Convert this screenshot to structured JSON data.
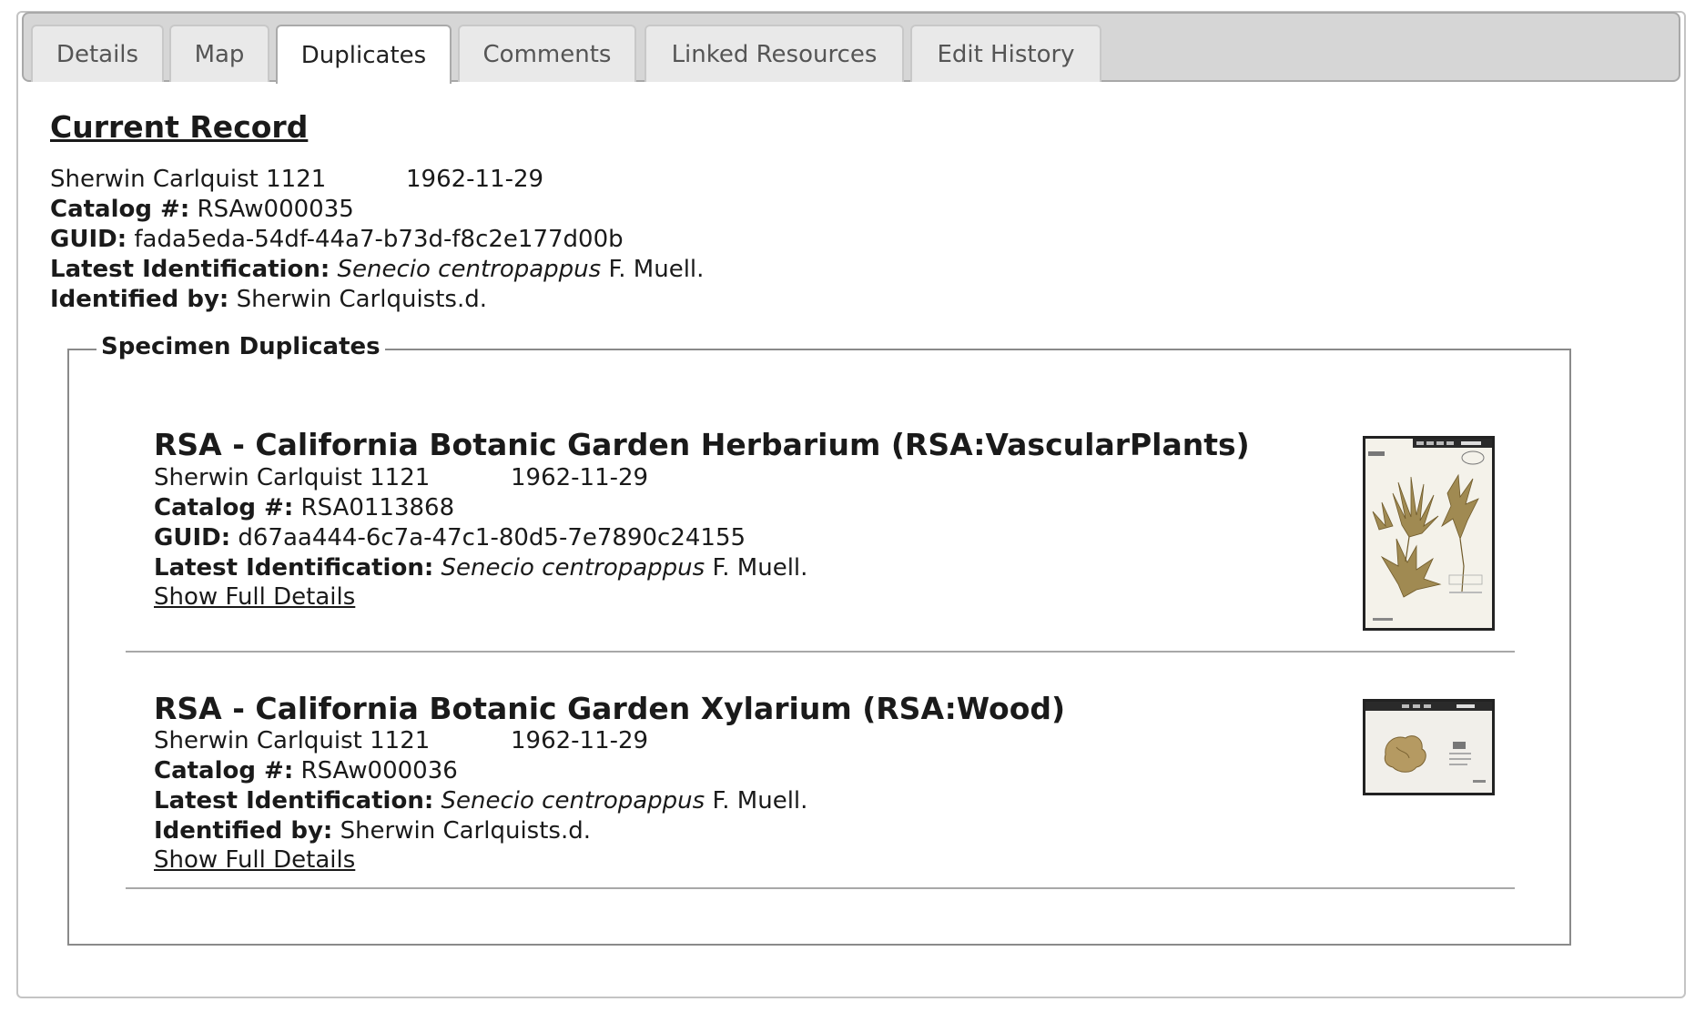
{
  "tabs": [
    {
      "label": "Details"
    },
    {
      "label": "Map"
    },
    {
      "label": "Duplicates"
    },
    {
      "label": "Comments"
    },
    {
      "label": "Linked Resources"
    },
    {
      "label": "Edit History"
    }
  ],
  "current_record": {
    "heading": "Current Record",
    "collector": "Sherwin Carlquist 1121",
    "date": "1962-11-29",
    "catalog_label": "Catalog #:",
    "catalog_value": "RSAw000035",
    "guid_label": "GUID:",
    "guid_value": "fada5eda-54df-44a7-b73d-f8c2e177d00b",
    "latest_id_label": "Latest Identification:",
    "latest_id_taxon": "Senecio centropappus",
    "latest_id_author": "F. Muell.",
    "identified_by_label": "Identified by:",
    "identified_by_value": "Sherwin Carlquists.d."
  },
  "duplicates": {
    "legend": "Specimen Duplicates",
    "items": [
      {
        "title": "RSA - California Botanic Garden Herbarium (RSA:VascularPlants)",
        "collector": "Sherwin Carlquist 1121",
        "date": "1962-11-29",
        "catalog_label": "Catalog #:",
        "catalog_value": "RSA0113868",
        "guid_label": "GUID:",
        "guid_value": "d67aa444-6c7a-47c1-80d5-7e7890c24155",
        "latest_id_label": "Latest Identification:",
        "latest_id_taxon": "Senecio centropappus",
        "latest_id_author": "F. Muell.",
        "link": "Show Full Details"
      },
      {
        "title": "RSA - California Botanic Garden Xylarium (RSA:Wood)",
        "collector": "Sherwin Carlquist 1121",
        "date": "1962-11-29",
        "catalog_label": "Catalog #:",
        "catalog_value": "RSAw000036",
        "latest_id_label": "Latest Identification:",
        "latest_id_taxon": "Senecio centropappus",
        "latest_id_author": "F. Muell.",
        "identified_by_label": "Identified by:",
        "identified_by_value": "Sherwin Carlquists.d.",
        "link": "Show Full Details"
      }
    ]
  }
}
